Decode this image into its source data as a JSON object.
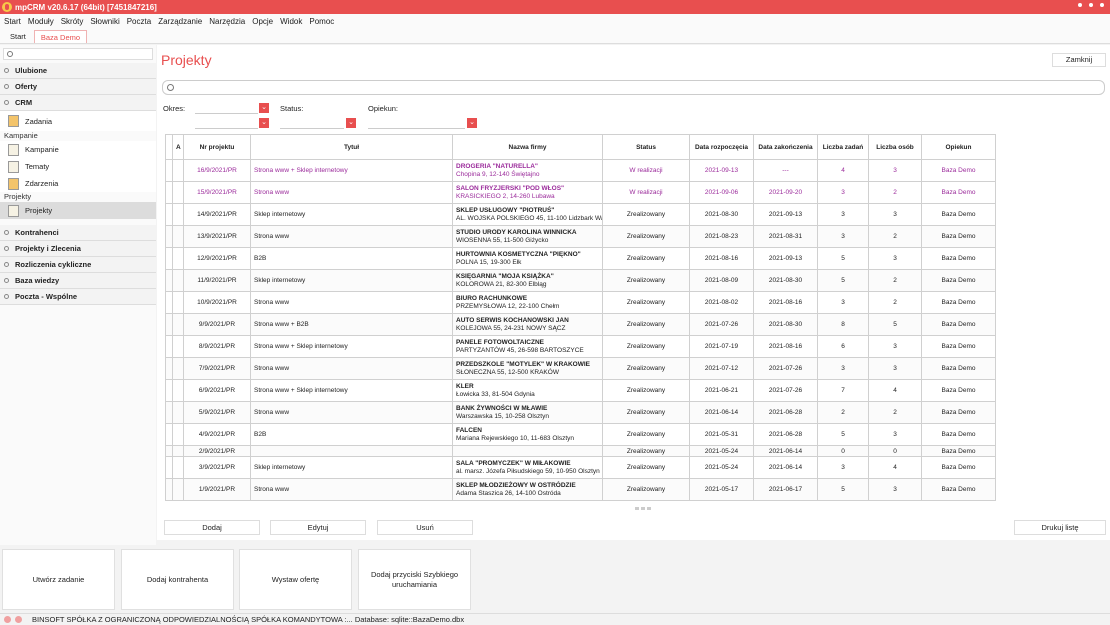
{
  "window": {
    "title": "mpCRM v20.6.17 (64bit) [7451847216]"
  },
  "menu": [
    "Start",
    "Moduły",
    "Skróty",
    "Słowniki",
    "Poczta",
    "Zarządzanie",
    "Narzędzia",
    "Opcje",
    "Widok",
    "Pomoc"
  ],
  "tabs": [
    "Start",
    "Baza Demo"
  ],
  "sidebar": {
    "groups_top": [
      "Ulubione",
      "Oferty",
      "CRM"
    ],
    "crm_item": "Zadania",
    "kampanie_label": "Kampanie",
    "kampanie_items": [
      "Kampanie",
      "Tematy",
      "Zdarzenia"
    ],
    "projekty_label": "Projekty",
    "projekty_item": "Projekty",
    "groups_bottom": [
      "Kontrahenci",
      "Projekty i Zlecenia",
      "Rozliczenia cykliczne",
      "Baza wiedzy",
      "Poczta - Wspólne"
    ]
  },
  "main": {
    "title": "Projekty",
    "close_label": "Zamknij",
    "filters": {
      "okres": "Okres:",
      "status": "Status:",
      "opiekun": "Opiekun:"
    },
    "columns": [
      "A",
      "Nr projektu",
      "Tytuł",
      "Nazwa firmy",
      "Status",
      "Data rozpoczęcia",
      "Data zakończenia",
      "Liczba zadań",
      "Liczba osób",
      "Opiekun"
    ],
    "rows": [
      {
        "nr": "16/9/2021/PR",
        "tytul": "Strona www + Sklep internetowy",
        "firma": "DROGERIA \"NATURELLA\"",
        "adres": "Chopina 9, 12-140 Świętajno",
        "status": "W realizacji",
        "start": "2021-09-13",
        "end": "---",
        "zadan": "4",
        "osob": "3",
        "opiekun": "Baza Demo"
      },
      {
        "nr": "15/9/2021/PR",
        "tytul": "Strona www",
        "firma": "SALON FRYZJERSKI \"POD WŁOS\"",
        "adres": "KRASICKIEGO 2, 14-260 Lubawa",
        "status": "W realizacji",
        "start": "2021-09-06",
        "end": "2021-09-20",
        "zadan": "3",
        "osob": "2",
        "opiekun": "Baza Demo"
      },
      {
        "nr": "14/9/2021/PR",
        "tytul": "Sklep internetowy",
        "firma": "SKLEP USŁUGOWY \"PIOTRUŚ\"",
        "adres": "AL. WOJSKA POLSKIEGO 45, 11-100 Lidzbark Wa",
        "status": "Zrealizowany",
        "start": "2021-08-30",
        "end": "2021-09-13",
        "zadan": "3",
        "osob": "3",
        "opiekun": "Baza Demo"
      },
      {
        "nr": "13/9/2021/PR",
        "tytul": "Strona www",
        "firma": "STUDIO URODY KAROLINA WINNICKA",
        "adres": "WIOSENNA 55, 11-500 Giżycko",
        "status": "Zrealizowany",
        "start": "2021-08-23",
        "end": "2021-08-31",
        "zadan": "3",
        "osob": "2",
        "opiekun": "Baza Demo"
      },
      {
        "nr": "12/9/2021/PR",
        "tytul": "B2B",
        "firma": "HURTOWNIA KOSMETYCZNA \"PIĘKNO\"",
        "adres": "POLNA 15, 19-300 Ełk",
        "status": "Zrealizowany",
        "start": "2021-08-16",
        "end": "2021-09-13",
        "zadan": "5",
        "osob": "3",
        "opiekun": "Baza Demo"
      },
      {
        "nr": "11/9/2021/PR",
        "tytul": "Sklep internetowy",
        "firma": "KSIĘGARNIA \"MOJA KSIĄŻKA\"",
        "adres": "KOLOROWA 21, 82-300 Elbląg",
        "status": "Zrealizowany",
        "start": "2021-08-09",
        "end": "2021-08-30",
        "zadan": "5",
        "osob": "2",
        "opiekun": "Baza Demo"
      },
      {
        "nr": "10/9/2021/PR",
        "tytul": "Strona www",
        "firma": "BIURO RACHUNKOWE",
        "adres": "PRZEMYSŁOWA 12, 22-100 Chełm",
        "status": "Zrealizowany",
        "start": "2021-08-02",
        "end": "2021-08-16",
        "zadan": "3",
        "osob": "2",
        "opiekun": "Baza Demo"
      },
      {
        "nr": "9/9/2021/PR",
        "tytul": "Strona www + B2B",
        "firma": "AUTO SERWIS KOCHANOWSKI JAN",
        "adres": "KOLEJOWA 55, 24-231 NOWY SĄCZ",
        "status": "Zrealizowany",
        "start": "2021-07-26",
        "end": "2021-08-30",
        "zadan": "8",
        "osob": "5",
        "opiekun": "Baza Demo"
      },
      {
        "nr": "8/9/2021/PR",
        "tytul": "Strona www + Sklep internetowy",
        "firma": "PANELE FOTOWOLTAICZNE",
        "adres": "PARTYZANTÓW 45, 26-598 BARTOSZYCE",
        "status": "Zrealizowany",
        "start": "2021-07-19",
        "end": "2021-08-16",
        "zadan": "6",
        "osob": "3",
        "opiekun": "Baza Demo"
      },
      {
        "nr": "7/9/2021/PR",
        "tytul": "Strona www",
        "firma": "PRZEDSZKOLE \"MOTYLEK\" W KRAKOWIE",
        "adres": "SŁONECZNA 55, 12-500 KRAKÓW",
        "status": "Zrealizowany",
        "start": "2021-07-12",
        "end": "2021-07-26",
        "zadan": "3",
        "osob": "3",
        "opiekun": "Baza Demo"
      },
      {
        "nr": "6/9/2021/PR",
        "tytul": "Strona www + Sklep internetowy",
        "firma": "KLER",
        "adres": "Łowicka 33, 81-504 Gdynia",
        "status": "Zrealizowany",
        "start": "2021-06-21",
        "end": "2021-07-26",
        "zadan": "7",
        "osob": "4",
        "opiekun": "Baza Demo"
      },
      {
        "nr": "5/9/2021/PR",
        "tytul": "Strona www",
        "firma": "BANK ŻYWNOŚCI W MŁAWIE",
        "adres": "Warszawska 15, 10-258 Olsztyn",
        "status": "Zrealizowany",
        "start": "2021-06-14",
        "end": "2021-06-28",
        "zadan": "2",
        "osob": "2",
        "opiekun": "Baza Demo"
      },
      {
        "nr": "4/9/2021/PR",
        "tytul": "B2B",
        "firma": "FALCEN",
        "adres": "Mariana Rejewskiego 10, 11-683 Olsztyn",
        "status": "Zrealizowany",
        "start": "2021-05-31",
        "end": "2021-06-28",
        "zadan": "5",
        "osob": "3",
        "opiekun": "Baza Demo"
      },
      {
        "nr": "2/9/2021/PR",
        "tytul": "",
        "firma": "",
        "adres": "",
        "status": "Zrealizowany",
        "start": "2021-05-24",
        "end": "2021-06-14",
        "zadan": "0",
        "osob": "0",
        "opiekun": "Baza Demo"
      },
      {
        "nr": "3/9/2021/PR",
        "tytul": "Sklep internetowy",
        "firma": "SALA \"PROMYCZEK\" W MIŁAKOWIE",
        "adres": "al. marsz. Józefa Piłsudskiego 59, 10-950 Olsztyn",
        "status": "Zrealizowany",
        "start": "2021-05-24",
        "end": "2021-06-14",
        "zadan": "3",
        "osob": "4",
        "opiekun": "Baza Demo"
      },
      {
        "nr": "1/9/2021/PR",
        "tytul": "Strona www",
        "firma": "SKLEP MŁODZIEŻOWY W OSTRÓDZIE",
        "adres": "Adama Staszica 26, 14-100 Ostróda",
        "status": "Zrealizowany",
        "start": "2021-05-17",
        "end": "2021-06-17",
        "zadan": "5",
        "osob": "3",
        "opiekun": "Baza Demo"
      }
    ],
    "buttons": {
      "add": "Dodaj",
      "edit": "Edytuj",
      "delete": "Usuń",
      "print": "Drukuj listę"
    }
  },
  "quick_actions": [
    "Utwórz zadanie",
    "Dodaj kontrahenta",
    "Wystaw ofertę",
    "Dodaj przyciski Szybkiego uruchamiania"
  ],
  "status_bar": {
    "text": "BINSOFT SPÓŁKA Z OGRANICZONĄ ODPOWIEDZIALNOŚCIĄ SPÓŁKA KOMANDYTOWA :... Database: sqlite::BazaDemo.dbx"
  },
  "colors": {
    "accent": "#e84f4f",
    "highlight_text": "#9b2b9b"
  }
}
